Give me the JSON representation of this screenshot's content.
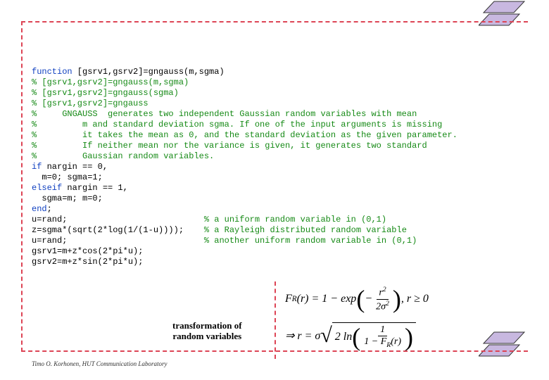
{
  "code": {
    "l1a": "function",
    "l1b": " [gsrv1,gsrv2]=gngauss(m,sgma)",
    "l2": "% [gsrv1,gsrv2]=gngauss(m,sgma)",
    "l3": "% [gsrv1,gsrv2]=gngauss(sgma)",
    "l4": "% [gsrv1,gsrv2]=gngauss",
    "l5": "%     GNGAUSS  generates two independent Gaussian random variables with mean",
    "l6": "%         m and standard deviation sgma. If one of the input arguments is missing",
    "l7": "%         it takes the mean as 0, and the standard deviation as the given parameter.",
    "l8": "%         If neither mean nor the variance is given, it generates two standard",
    "l9": "%         Gaussian random variables.",
    "l10a": "if",
    "l10b": " nargin == 0,",
    "l11": "  m=0; sgma=1;",
    "l12a": "elseif",
    "l12b": " nargin == 1,",
    "l13": "  sgma=m; m=0;",
    "l14a": "end",
    "l14b": ";",
    "l15a": "u=rand;                           ",
    "l15b": "% a uniform random variable in (0,1)",
    "l16a": "z=sgma*(sqrt(2*log(1/(1-u))));    ",
    "l16b": "% a Rayleigh distributed random variable",
    "l17a": "u=rand;                           ",
    "l17b": "% another uniform random variable in (0,1)",
    "l18": "gsrv1=m+z*cos(2*pi*u);",
    "l19": "gsrv2=m+z*sin(2*pi*u);"
  },
  "transform_label_l1": "transformation of",
  "transform_label_l2": "random variables",
  "footer": "Timo O. Korhonen, HUT Communication Laboratory",
  "math": {
    "eq1_lhs": "F",
    "eq1_sub": "R",
    "eq1_arg": "(r) = 1 − exp",
    "eq1_frac_num": "r",
    "eq1_frac_den": "2σ",
    "eq1_tail": ", r ≥ 0",
    "eq2_lhs": "⇒ r = σ",
    "eq2_inner": "2 ln",
    "eq2_frac_num": "1",
    "eq2_frac_den_a": "1 − F",
    "eq2_frac_den_sub": "R",
    "eq2_frac_den_b": "(r)"
  }
}
